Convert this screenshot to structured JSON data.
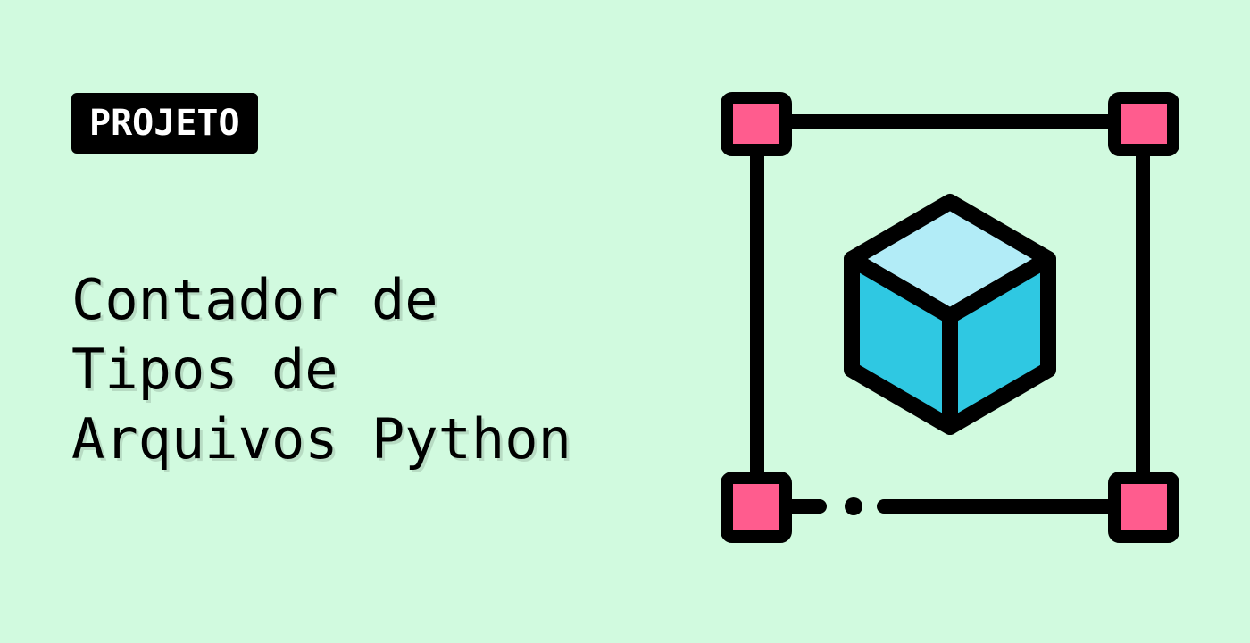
{
  "tag": {
    "label": "PROJETO"
  },
  "title": {
    "lines": [
      "Contador de",
      "Tipos de",
      "Arquivos Python"
    ]
  },
  "illustration": {
    "icon": "3d-cube-bounding-box-icon",
    "colors": {
      "outline": "#000000",
      "corner_handle": "#ff5c8e",
      "cube_top": "#b2ecf7",
      "cube_sides": "#2fc8e2"
    }
  },
  "colors": {
    "background": "#d1fadf",
    "tag_background": "#000000",
    "tag_text": "#ffffff",
    "title_text": "#000000"
  }
}
